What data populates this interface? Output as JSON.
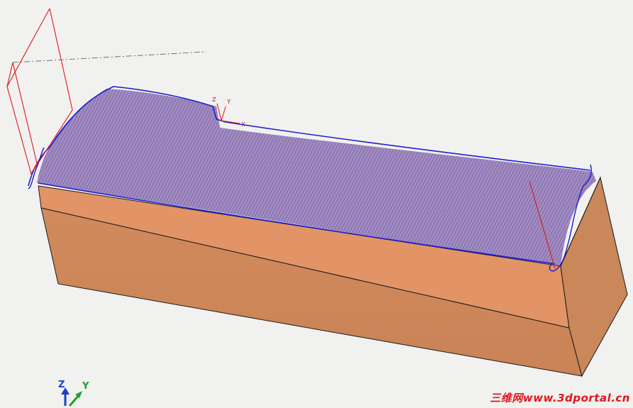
{
  "scene": {
    "workpiece_color": "#e29466",
    "toolpath_color": "#2020c8",
    "tool_color": "#e01818"
  },
  "local_axes": {
    "z": "Z",
    "y": "Y",
    "x": "X"
  },
  "view_triad": {
    "z": "Z",
    "y": "Y"
  },
  "watermark": "三维网www.3dportal.cn"
}
